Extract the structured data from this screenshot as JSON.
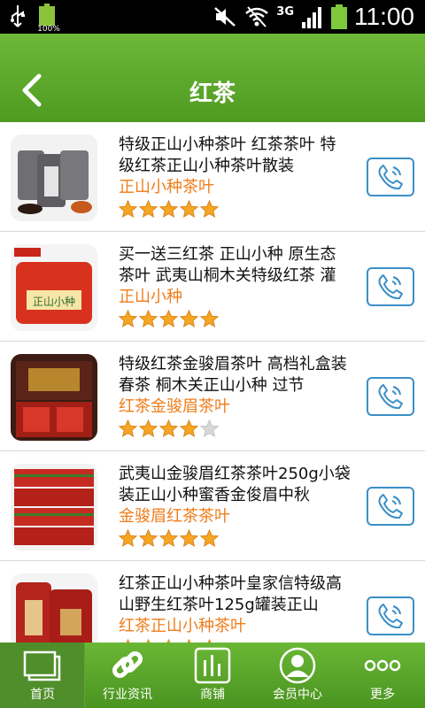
{
  "status_bar": {
    "battery_percent_label": "100%",
    "network": "3G",
    "time": "11:00"
  },
  "header": {
    "title": "红茶"
  },
  "products": [
    {
      "description": "特级正山小种茶叶 红茶茶叶 特级红茶正山小种茶叶散装",
      "name": "正山小种茶叶",
      "rating": 5,
      "thumb_color": "#6f6f73"
    },
    {
      "description": "买一送三红茶 正山小种 原生态茶叶 武夷山桐木关特级红茶 灌",
      "name": "正山小种",
      "rating": 5,
      "thumb_color": "#d8321f"
    },
    {
      "description": "特级红茶金骏眉茶叶 高档礼盒装 春茶 桐木关正山小种 过节",
      "name": "红茶金骏眉茶叶",
      "rating": 4,
      "thumb_color": "#7a1c12"
    },
    {
      "description": "武夷山金骏眉红茶茶叶250g小袋装正山小种蜜香金俊眉中秋",
      "name": "金骏眉红茶茶叶",
      "rating": 5,
      "thumb_color": "#c62b22"
    },
    {
      "description": "红茶正山小种茶叶皇家信特级高山野生红茶叶125g罐装正山",
      "name": "红茶正山小种茶叶",
      "rating": 5,
      "thumb_color": "#b5231d"
    }
  ],
  "tabs": [
    {
      "label": "首页",
      "icon": "home-icon",
      "active": true
    },
    {
      "label": "行业资讯",
      "icon": "link-icon",
      "active": false
    },
    {
      "label": "商铺",
      "icon": "shop-chart-icon",
      "active": false
    },
    {
      "label": "会员中心",
      "icon": "user-icon",
      "active": false
    },
    {
      "label": "更多",
      "icon": "more-dots-icon",
      "active": false
    }
  ],
  "colors": {
    "header_green": "#5aa82c",
    "accent_orange": "#f07d1a",
    "call_blue": "#3b8fc7",
    "star_gold": "#f6a623",
    "star_gray": "#d8d8d8"
  }
}
